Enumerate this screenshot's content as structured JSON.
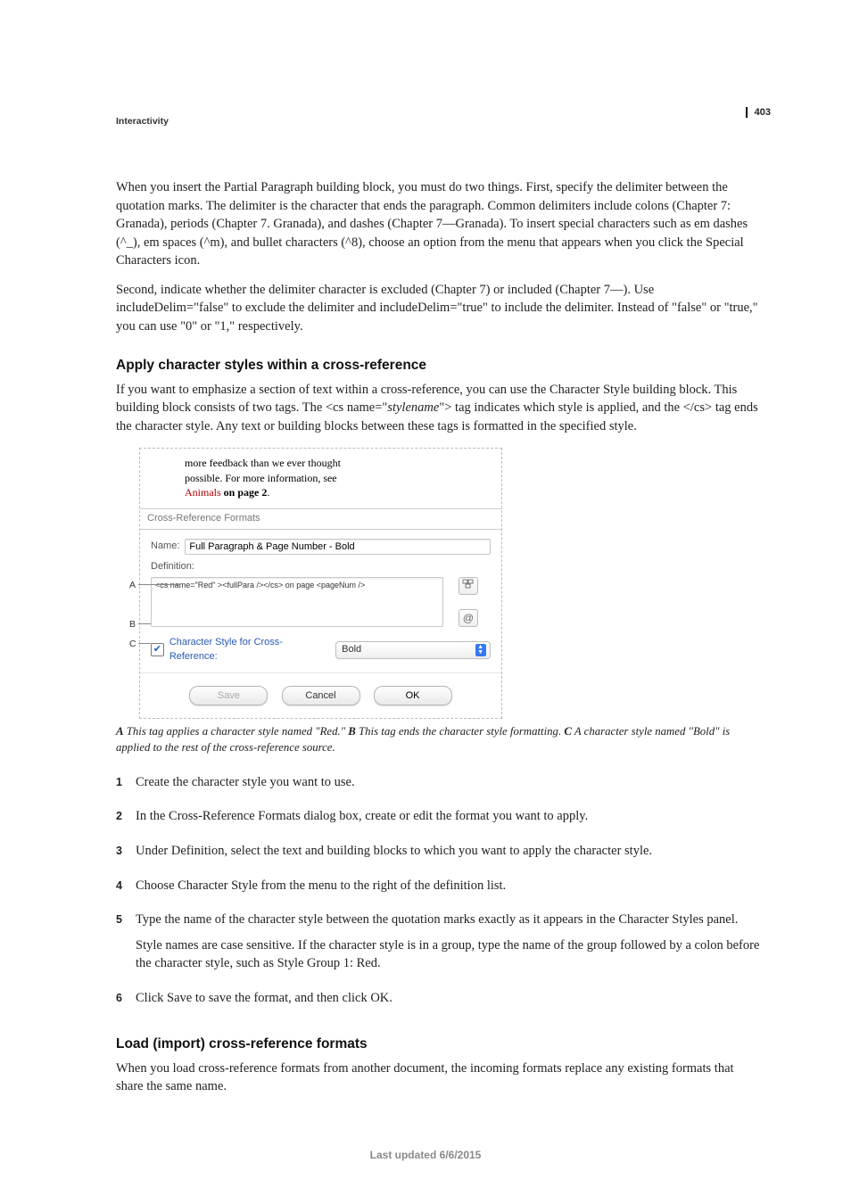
{
  "page_number": "403",
  "breadcrumb": "Interactivity",
  "para1": "When you insert the Partial Paragraph building block, you must do two things. First, specify the delimiter between the quotation marks. The delimiter is the character that ends the paragraph. Common delimiters include colons (Chapter 7: Granada), periods (Chapter 7. Granada), and dashes (Chapter 7—Granada). To insert special characters such as em dashes (^_), em spaces (^m), and bullet characters (^8), choose an option from the menu that appears when you click the Special Characters icon.",
  "para2": "Second, indicate whether the delimiter character is excluded (Chapter 7) or included (Chapter 7—). Use includeDelim=\"false\" to exclude the delimiter and includeDelim=\"true\" to include the delimiter. Instead of \"false\" or \"true,\" you can use \"0\" or \"1,\" respectively.",
  "h_applycs": "Apply character styles within a cross-reference",
  "para3_a": "If you want to emphasize a section of text within a cross-reference, you can use the Character Style building block. This building block consists of two tags. The <cs name=\"",
  "para3_style": "stylename",
  "para3_b": "\"> tag indicates which style is applied, and the </cs> tag ends the character style. Any text or building blocks between these tags is formatted in the specified style.",
  "figure": {
    "preview_line1": "more feedback than we ever thought",
    "preview_line2": "possible. For more information, see",
    "preview_red": "Animals",
    "preview_bold": " on page 2",
    "section_title": "Cross-Reference Formats",
    "name_label": "Name:",
    "name_value": "Full Paragraph & Page Number - Bold",
    "def_label": "Definition:",
    "code_a": "<cs name=\"Red\" >",
    "code_b": "<fullPara /></cs>",
    "code_c": " on page <pageNum />",
    "callout_A": "A",
    "callout_B": "B",
    "callout_C": "C",
    "icon_spec_name": "building-blocks-icon",
    "icon_at_name": "special-characters-icon",
    "cs_check_label": "Character Style for Cross-Reference:",
    "cs_select_value": "Bold",
    "btn_save": "Save",
    "btn_cancel": "Cancel",
    "btn_ok": "OK"
  },
  "caption": {
    "A_lead": "A",
    "A_text": " This tag applies a character style named \"Red.\"  ",
    "B_lead": "B",
    "B_text": " This tag ends the character style formatting.  ",
    "C_lead": "C",
    "C_text": " A character style named \"Bold\" is applied to the rest of the cross-reference source."
  },
  "steps": {
    "s1": "Create the character style you want to use.",
    "s2": "In the Cross-Reference Formats dialog box, create or edit the format you want to apply.",
    "s3": "Under Definition, select the text and building blocks to which you want to apply the character style.",
    "s4": "Choose Character Style from the menu to the right of the definition list.",
    "s5a": "Type the name of the character style between the quotation marks exactly as it appears in the Character Styles panel.",
    "s5b": "Style names are case sensitive. If the character style is in a group, type the name of the group followed by a colon before the character style, such as Style Group 1: Red.",
    "s6": "Click Save to save the format, and then click OK."
  },
  "h_load": "Load (import) cross-reference formats",
  "para4": "When you load cross-reference formats from another document, the incoming formats replace any existing formats that share the same name.",
  "footer": "Last updated 6/6/2015",
  "nums": {
    "n1": "1",
    "n2": "2",
    "n3": "3",
    "n4": "4",
    "n5": "5",
    "n6": "6"
  }
}
